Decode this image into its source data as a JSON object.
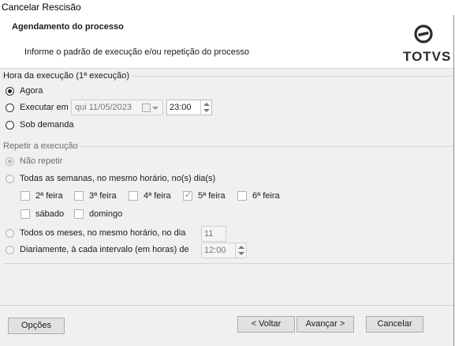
{
  "window": {
    "title": "Cancelar Rescisão"
  },
  "header": {
    "title": "Agendamento do processo",
    "subtitle": "Informe o padrão de execução e/ou repetição do processo",
    "logo_text": "TOTVS"
  },
  "execution": {
    "group_label": "Hora da execução (1ª execução)",
    "options": [
      {
        "label": "Agora",
        "selected": true
      },
      {
        "label": "Executar em",
        "selected": false
      },
      {
        "label": "Sob demanda",
        "selected": false
      }
    ],
    "date_value": "qui  11/05/2023",
    "time_value": "23:00"
  },
  "repeat": {
    "group_label": "Repetir a execução",
    "no_repeat": "Não repetir",
    "weekly": "Todas as semanas, no mesmo horário, no(s) dia(s)",
    "days": [
      {
        "label": "2ª feira",
        "checked": false
      },
      {
        "label": "3ª feira",
        "checked": false
      },
      {
        "label": "4ª feira",
        "checked": false
      },
      {
        "label": "5ª feira",
        "checked": true
      },
      {
        "label": "6ª feira",
        "checked": false
      },
      {
        "label": "sábado",
        "checked": false
      },
      {
        "label": "domingo",
        "checked": false
      }
    ],
    "monthly": "Todos os meses, no mesmo horário, no dia",
    "monthly_day": "11",
    "daily": "Diariamente, à cada intervalo (em horas) de",
    "interval_value": "12:00"
  },
  "footer": {
    "options_button": "Opções",
    "back_button": "< Voltar",
    "next_button": "Avançar >",
    "cancel_button": "Cancelar"
  }
}
